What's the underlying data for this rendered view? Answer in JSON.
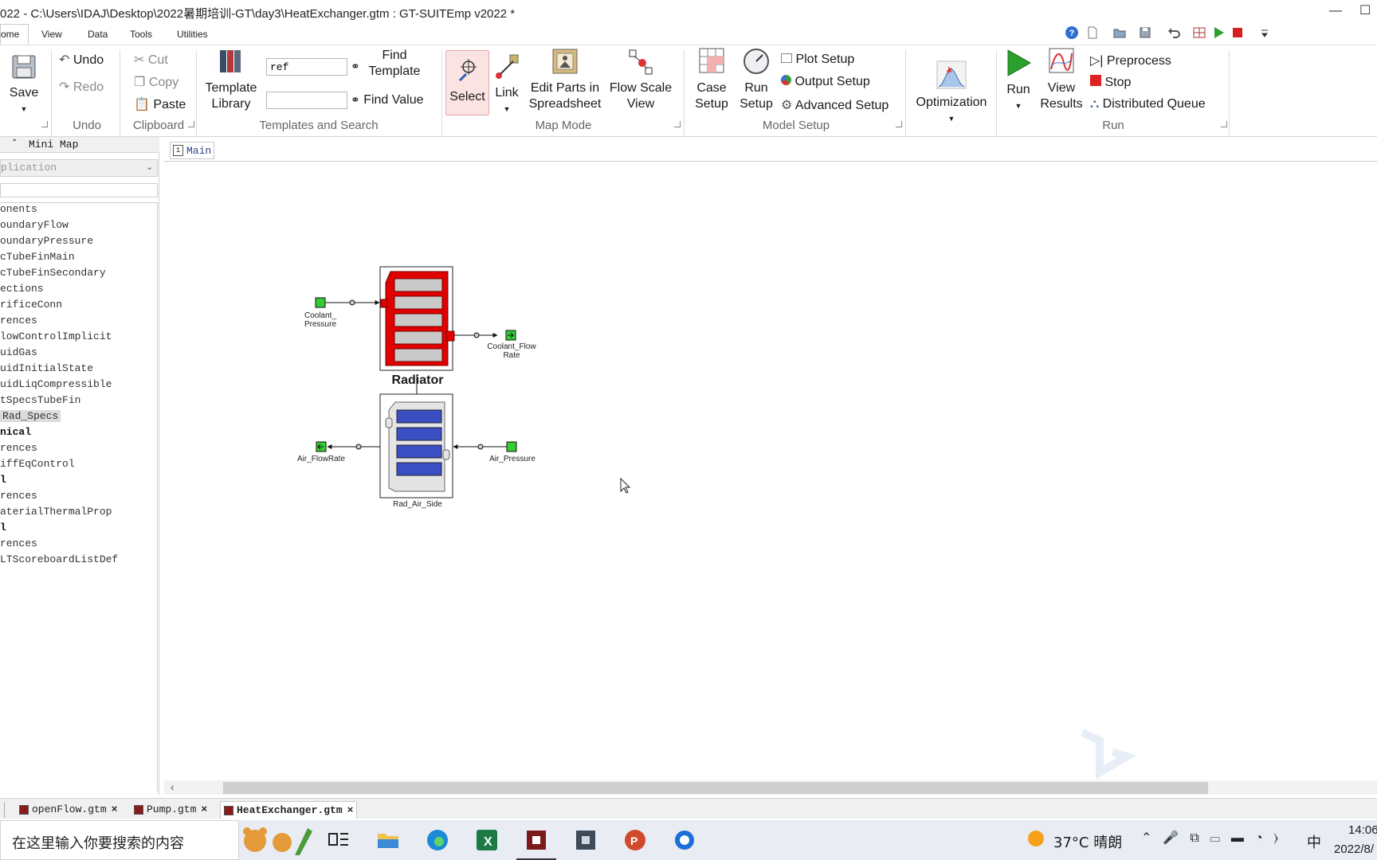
{
  "window": {
    "title": "022 - C:\\Users\\IDAJ\\Desktop\\2022暑期培训-GT\\day3\\HeatExchanger.gtm : GT-SUITEmp v2022 *",
    "min": "—",
    "max": "☐"
  },
  "menu": {
    "home": "ome",
    "items": [
      "View",
      "Data",
      "Tools",
      "Utilities"
    ]
  },
  "ribbon": {
    "save": "Save",
    "undo": "Undo",
    "redo": "Redo",
    "undo_group": "Undo",
    "cut": "Cut",
    "copy": "Copy",
    "paste": "Paste",
    "clipboard_group": "Clipboard",
    "template_library_1": "Template",
    "template_library_2": "Library",
    "search_value": "ref",
    "find_value_input": "",
    "find_template_1": "Find",
    "find_template_2": "Template",
    "find_value": "Find Value",
    "templates_group": "Templates and Search",
    "select": "Select",
    "link": "Link",
    "edit_parts_1": "Edit Parts in",
    "edit_parts_2": "Spreadsheet",
    "flow_scale_1": "Flow Scale",
    "flow_scale_2": "View",
    "map_mode_group": "Map Mode",
    "case_setup_1": "Case",
    "case_setup_2": "Setup",
    "run_setup_1": "Run",
    "run_setup_2": "Setup",
    "plot_setup": "Plot Setup",
    "output_setup": "Output Setup",
    "advanced_setup": "Advanced Setup",
    "model_setup_group": "Model Setup",
    "optimization": "Optimization",
    "run": "Run",
    "view_results_1": "View",
    "view_results_2": "Results",
    "preprocess": "Preprocess",
    "stop": "Stop",
    "distributed_queue": "Distributed Queue",
    "run_group": "Run"
  },
  "left_panel": {
    "minimap": "Mini Map",
    "application": "plication",
    "tree": [
      {
        "label": "onents",
        "bold": false
      },
      {
        "label": "oundaryFlow",
        "bold": false
      },
      {
        "label": "oundaryPressure",
        "bold": false
      },
      {
        "label": "cTubeFinMain",
        "bold": false
      },
      {
        "label": "cTubeFinSecondary",
        "bold": false
      },
      {
        "label": "ections",
        "bold": false
      },
      {
        "label": "rificeConn",
        "bold": false
      },
      {
        "label": "rences",
        "bold": false
      },
      {
        "label": "lowControlImplicit",
        "bold": false
      },
      {
        "label": "uidGas",
        "bold": false
      },
      {
        "label": "uidInitialState",
        "bold": false
      },
      {
        "label": "uidLiqCompressible",
        "bold": false
      },
      {
        "label": "tSpecsTubeFin",
        "bold": false
      },
      {
        "label": "Rad_Specs",
        "bold": false,
        "selected": true
      },
      {
        "label": "nical",
        "bold": true
      },
      {
        "label": "rences",
        "bold": false
      },
      {
        "label": "iffEqControl",
        "bold": false
      },
      {
        "label": "l",
        "bold": true
      },
      {
        "label": "rences",
        "bold": false
      },
      {
        "label": "aterialThermalProp",
        "bold": false
      },
      {
        "label": "l",
        "bold": true
      },
      {
        "label": "rences",
        "bold": false
      },
      {
        "label": "LTScoreboardListDef",
        "bold": false
      }
    ]
  },
  "canvas": {
    "tab": "Main",
    "tab_number": "1",
    "parts": {
      "coolant_pressure": "Coolant_\nPressure",
      "coolant_flow": "Coolant_Flow\nRate",
      "radiator": "Radiator",
      "rad_air_side": "Rad_Air_Side",
      "air_flowrate": "Air_FlowRate",
      "air_pressure": "Air_Pressure"
    }
  },
  "doc_tabs": [
    {
      "label": "openFlow.gtm",
      "active": false
    },
    {
      "label": "Pump.gtm",
      "active": false
    },
    {
      "label": "HeatExchanger.gtm",
      "active": true
    }
  ],
  "taskbar": {
    "search_placeholder": "在这里输入你要搜索的内容",
    "weather": "37°C 晴朗",
    "ime": "中",
    "time": "14:06",
    "date": "2022/8/"
  }
}
